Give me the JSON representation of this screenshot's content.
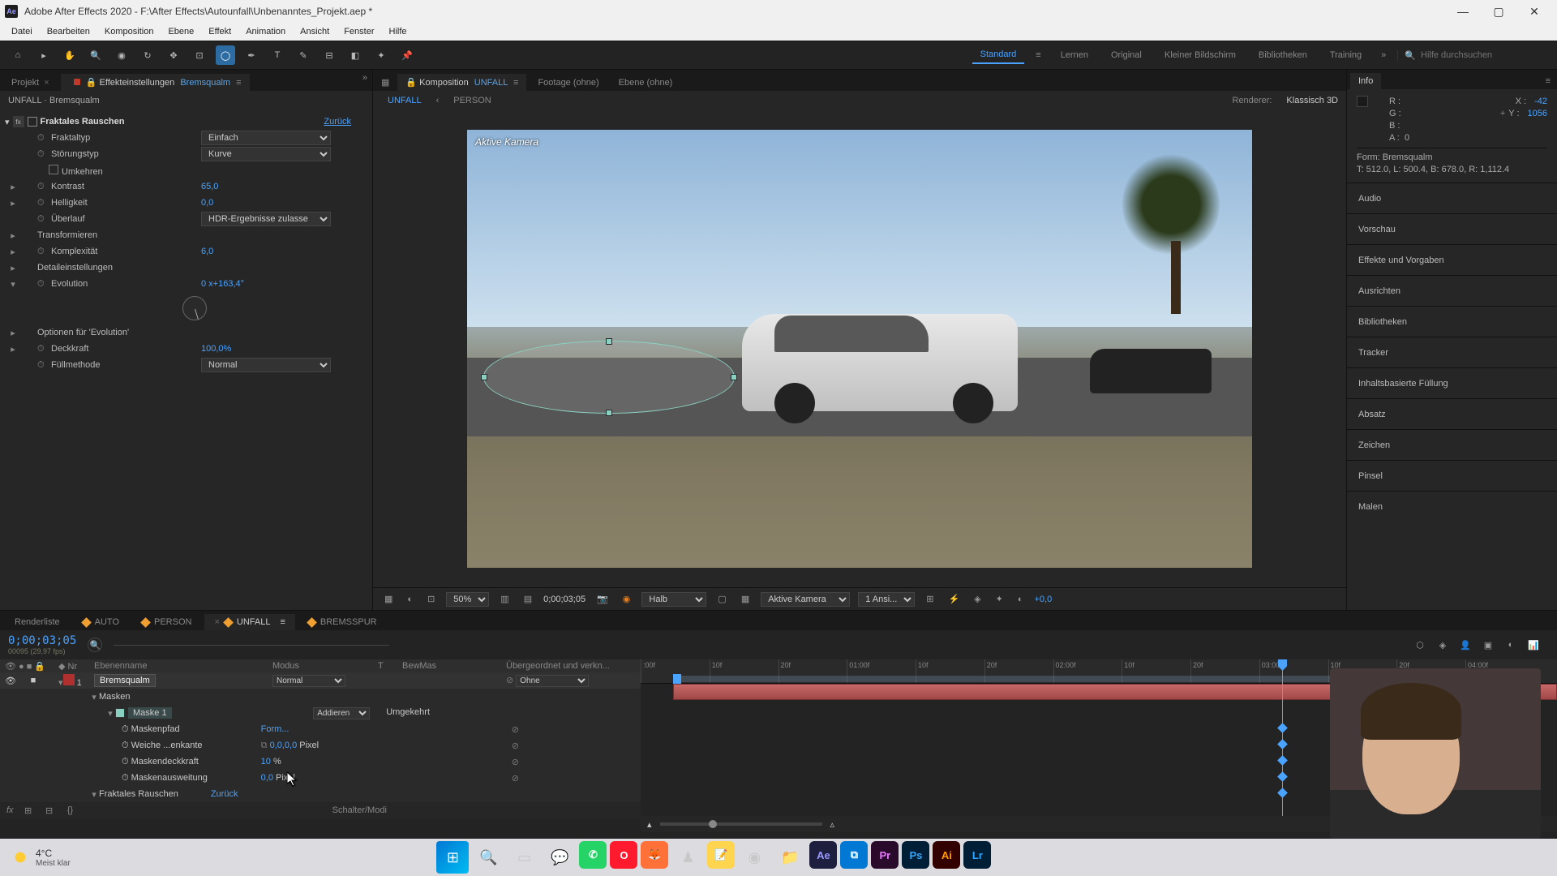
{
  "app": {
    "title": "Adobe After Effects 2020 - F:\\After Effects\\Autounfall\\Unbenanntes_Projekt.aep *"
  },
  "menu": [
    "Datei",
    "Bearbeiten",
    "Komposition",
    "Ebene",
    "Effekt",
    "Animation",
    "Ansicht",
    "Fenster",
    "Hilfe"
  ],
  "workspaces": {
    "items": [
      "Standard",
      "Lernen",
      "Original",
      "Kleiner Bildschirm",
      "Bibliotheken",
      "Training"
    ],
    "active": "Standard",
    "search_placeholder": "Hilfe durchsuchen"
  },
  "left_panel": {
    "tabs": {
      "project": "Projekt",
      "effect_controls": "Effekteinstellungen",
      "effect_controls_target": "Bremsqualm"
    },
    "breadcrumb": "UNFALL · Bremsqualm",
    "effect": {
      "name": "Fraktales Rauschen",
      "reset": "Zurück",
      "props": {
        "fraktaltyp": {
          "label": "Fraktaltyp",
          "value": "Einfach"
        },
        "stoerungstyp": {
          "label": "Störungstyp",
          "value": "Kurve"
        },
        "umkehren": {
          "label": "Umkehren"
        },
        "kontrast": {
          "label": "Kontrast",
          "value": "65,0"
        },
        "helligkeit": {
          "label": "Helligkeit",
          "value": "0,0"
        },
        "ueberlauf": {
          "label": "Überlauf",
          "value": "HDR-Ergebnisse zulasse"
        },
        "transformieren": {
          "label": "Transformieren"
        },
        "komplexitaet": {
          "label": "Komplexität",
          "value": "6,0"
        },
        "detail": {
          "label": "Detaileinstellungen"
        },
        "evolution": {
          "label": "Evolution",
          "value": "0 x+163,4°"
        },
        "evo_options": {
          "label": "Optionen für 'Evolution'"
        },
        "deckkraft": {
          "label": "Deckkraft",
          "value": "100,0%"
        },
        "fuellmethode": {
          "label": "Füllmethode",
          "value": "Normal"
        }
      }
    }
  },
  "center": {
    "tabs": {
      "comp_prefix": "Komposition",
      "comp_name": "UNFALL",
      "footage": "Footage",
      "footage_val": "(ohne)",
      "ebene": "Ebene",
      "ebene_val": "(ohne)"
    },
    "nav": {
      "active": "UNFALL",
      "crumb2": "PERSON",
      "renderer_label": "Renderer:",
      "renderer_value": "Klassisch 3D"
    },
    "camera_label": "Aktive Kamera",
    "controls": {
      "zoom": "50%",
      "timecode": "0;00;03;05",
      "res": "Halb",
      "camera": "Aktive Kamera",
      "views": "1 Ansi...",
      "exposure": "+0,0"
    }
  },
  "right": {
    "info_tab": "Info",
    "rgba": {
      "r": "R :",
      "g": "G :",
      "b": "B :",
      "a": "A :",
      "a_val": "0"
    },
    "coords": {
      "x_label": "X :",
      "x_val": "-42",
      "y_label": "Y :",
      "y_val": "1056"
    },
    "shape_line": "Form: Bremsqualm",
    "bounds": "T: 512.0, L: 500.4, B: 678.0, R: 1,112.4",
    "sections": [
      "Audio",
      "Vorschau",
      "Effekte und Vorgaben",
      "Ausrichten",
      "Bibliotheken",
      "Tracker",
      "Inhaltsbasierte Füllung",
      "Absatz",
      "Zeichen",
      "Pinsel",
      "Malen"
    ]
  },
  "timeline": {
    "tabs": [
      "Renderliste",
      "AUTO",
      "PERSON",
      "UNFALL",
      "BREMSSPUR"
    ],
    "active_tab": "UNFALL",
    "time": "0;00;03;05",
    "time_sub": "00095 (29,97 fps)",
    "columns": {
      "nr": "Nr",
      "name": "Ebenenname",
      "mode": "Modus",
      "t": "T",
      "bew": "BewMas",
      "parent": "Übergeordnet und verkn..."
    },
    "layer": {
      "nr": "1",
      "name": "Bremsqualm",
      "mode": "Normal",
      "parent": "Ohne",
      "masks_group": "Masken",
      "mask1": "Maske 1",
      "mask_mode": "Addieren",
      "mask_invert": "Umgekehrt",
      "props": {
        "maskenpfad": {
          "label": "Maskenpfad",
          "value": "Form..."
        },
        "weiche": {
          "label": "Weiche ...enkante",
          "value": "0,0,0,0",
          "unit": "Pixel"
        },
        "deckkraft": {
          "label": "Maskendeckkraft",
          "value": "10",
          "unit": "%"
        },
        "ausweitung": {
          "label": "Maskenausweitung",
          "value": "0,0",
          "unit": "Pixel"
        }
      },
      "fraktales": "Fraktales Rauschen",
      "fraktales_reset": "Zurück"
    },
    "footer": "Schalter/Modi",
    "ruler": [
      ":00f",
      "10f",
      "20f",
      "01:00f",
      "10f",
      "20f",
      "02:00f",
      "10f",
      "20f",
      "03:00f",
      "10f",
      "20f",
      "04:00f"
    ]
  },
  "taskbar": {
    "temp": "4°C",
    "weather": "Meist klar"
  }
}
